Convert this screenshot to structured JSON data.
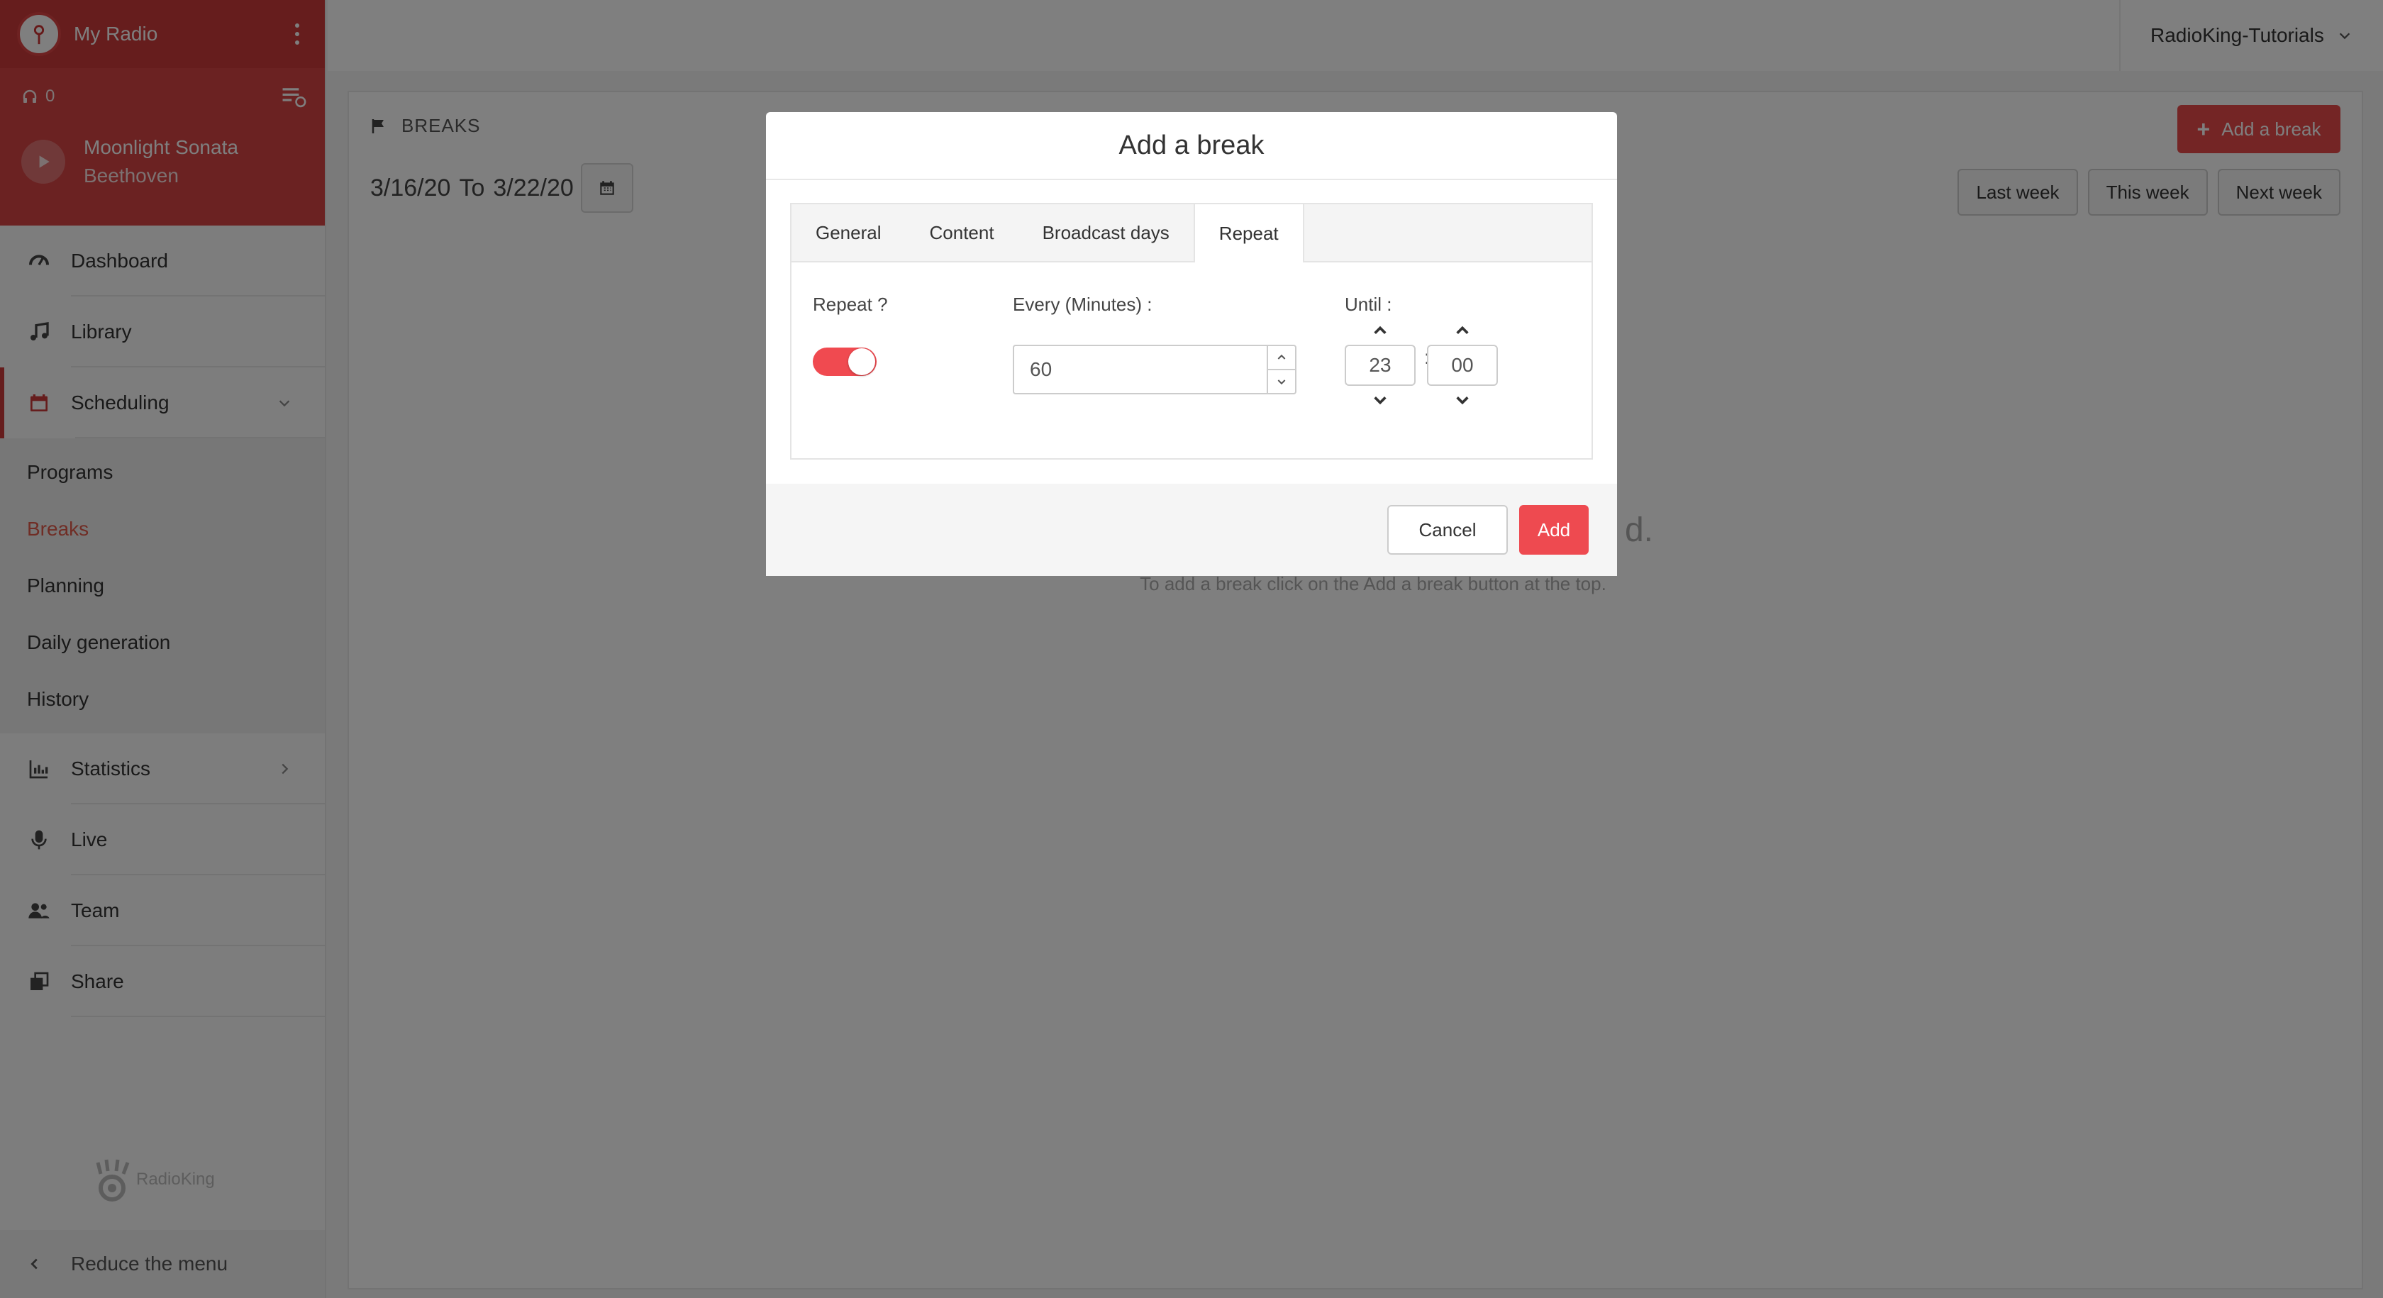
{
  "radio": {
    "name": "My Radio"
  },
  "player": {
    "listeners": "0",
    "track_title": "Moonlight Sonata",
    "track_artist": "Beethoven"
  },
  "nav": {
    "dashboard": "Dashboard",
    "library": "Library",
    "scheduling": "Scheduling",
    "sub": [
      "Programs",
      "Breaks",
      "Planning",
      "Daily generation",
      "History"
    ],
    "statistics": "Statistics",
    "live": "Live",
    "team": "Team",
    "share": "Share"
  },
  "brand": "RadioKing",
  "reduce_menu": "Reduce the menu",
  "account": "RadioKing-Tutorials",
  "page": {
    "title": "BREAKS",
    "add_break_label": "Add a break",
    "date_from": "3/16/20",
    "date_to_word": "To",
    "date_to": "3/22/20",
    "last_week": "Last week",
    "this_week": "This week",
    "next_week": "Next week",
    "empty_main": "d.",
    "empty_hint": "To add a break click on the Add a break button at the top."
  },
  "modal": {
    "title": "Add a break",
    "tabs": [
      "General",
      "Content",
      "Broadcast days",
      "Repeat"
    ],
    "active_tab": "Repeat",
    "repeat_label": "Repeat ?",
    "repeat_on": true,
    "every_label": "Every (Minutes) :",
    "every_value": "60",
    "until_label": "Until :",
    "until_hours": "23",
    "until_minutes": "00",
    "colon": ":",
    "cancel_label": "Cancel",
    "add_label": "Add"
  },
  "colors": {
    "brand_red": "#cc3b3b",
    "accent_red": "#ee4a50",
    "active_link": "#e05a4a"
  }
}
